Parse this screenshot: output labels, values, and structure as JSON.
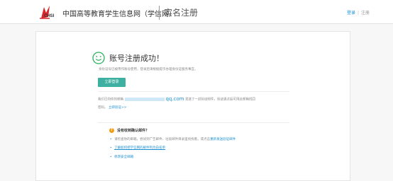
{
  "header": {
    "logo_text": "CHSI",
    "site_name": "中国高等教育学生信息网（学信网）",
    "page_title": "实名注册",
    "links": [
      "登录",
      "注册"
    ]
  },
  "result": {
    "title": "账号注册成功！",
    "description": "身份证号已被用作账号使用，登录后请根据提示办理身份证服务事宜。",
    "login_button": "立即登录"
  },
  "email": {
    "prefix": "我们已向你的邮箱",
    "domain": "qq.com",
    "suffix": "发送了一封验证邮件，验证通过后可用此邮箱找回",
    "line2": "密码。",
    "link": "立即验证>>"
  },
  "help": {
    "question": "没有收到确认邮件？",
    "bullets": [
      {
        "prefix": "请检查你的邮箱，尝试到广告邮件、垃圾邮件目录里找找看，或点击",
        "link": "重新发送验证邮件"
      },
      {
        "link": "了解如何把学信网的邮件列为白名单"
      },
      {
        "link": "修改安全邮箱"
      }
    ]
  },
  "colors": {
    "accent": "#1a8fd0",
    "button": "#3eb0a1",
    "success": "#27b35a",
    "warning": "#f39c12"
  }
}
